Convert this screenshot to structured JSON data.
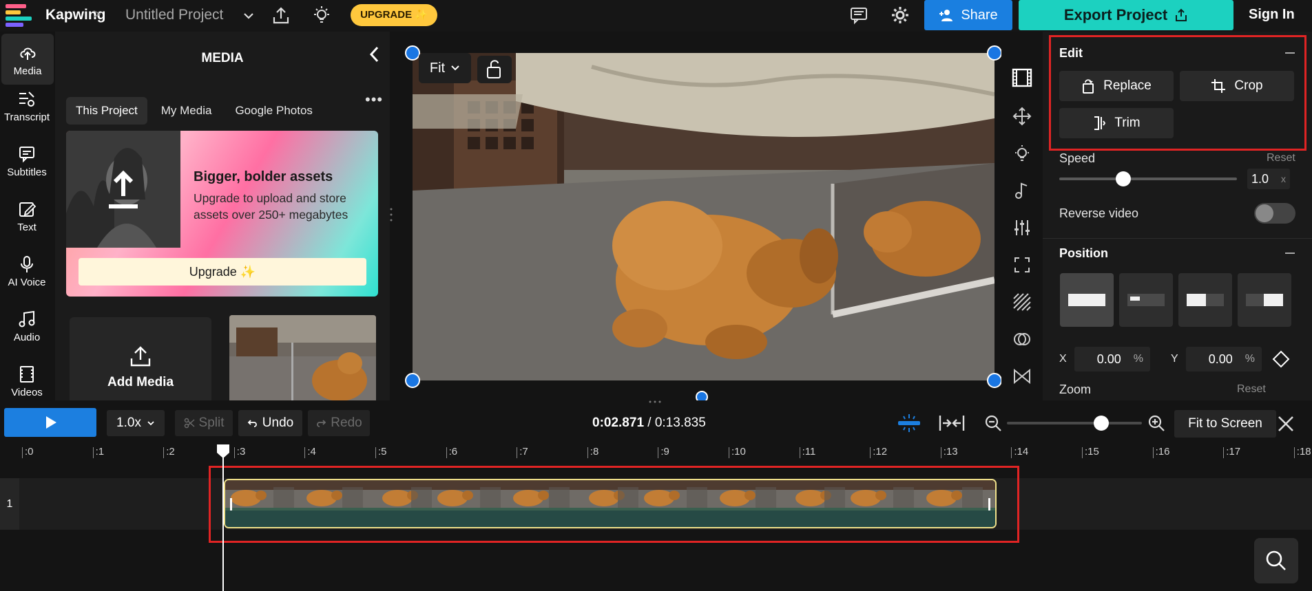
{
  "header": {
    "brand": "Kapwing",
    "separator": ">",
    "project_name": "Untitled Project",
    "upgrade_label": "UPGRADE ✨",
    "share_label": "Share",
    "export_label": "Export Project",
    "signin_label": "Sign In"
  },
  "rail": {
    "items": [
      {
        "label": "Media",
        "icon": "upload-cloud-icon"
      },
      {
        "label": "Transcript",
        "icon": "transcript-icon"
      },
      {
        "label": "Subtitles",
        "icon": "subtitles-icon"
      },
      {
        "label": "Text",
        "icon": "text-edit-icon"
      },
      {
        "label": "AI Voice",
        "icon": "microphone-icon"
      },
      {
        "label": "Audio",
        "icon": "music-note-icon"
      },
      {
        "label": "Videos",
        "icon": "film-icon"
      }
    ]
  },
  "media_panel": {
    "title": "MEDIA",
    "tabs": [
      "This Project",
      "My Media",
      "Google Photos"
    ],
    "more": "•••",
    "promo_title": "Bigger, bolder assets",
    "promo_text": "Upgrade to upload and store assets over 250+ megabytes",
    "promo_button": "Upgrade ✨",
    "add_media_label": "Add Media"
  },
  "canvas": {
    "fit_label": "Fit"
  },
  "edit": {
    "title": "Edit",
    "replace_label": "Replace",
    "crop_label": "Crop",
    "trim_label": "Trim"
  },
  "speed": {
    "label": "Speed",
    "reset": "Reset",
    "value": "1.0",
    "unit": "x",
    "slider_fraction": 0.36
  },
  "reverse": {
    "label": "Reverse video",
    "enabled": false
  },
  "position": {
    "title": "Position",
    "x_label": "X",
    "x_value": "0.00",
    "y_label": "Y",
    "y_value": "0.00",
    "unit": "%"
  },
  "zoom": {
    "label": "Zoom",
    "reset": "Reset"
  },
  "timeline": {
    "speed": "1.0x",
    "split": "Split",
    "undo": "Undo",
    "redo": "Redo",
    "current_time": "0:02.871",
    "duration": "/ 0:13.835",
    "fit_to_screen": "Fit to Screen",
    "zoom_fraction": 0.7,
    "track_number": "1",
    "ruler_ticks": [
      ":0",
      ":1",
      ":2",
      ":3",
      ":4",
      ":5",
      ":6",
      ":7",
      ":8",
      ":9",
      ":10",
      ":11",
      ":12",
      ":13",
      ":14",
      ":15",
      ":16",
      ":17",
      ":18"
    ]
  },
  "colors": {
    "accent_blue": "#1a7fe0",
    "export_teal": "#1cd1c0",
    "upgrade_yellow": "#ffc83d",
    "highlight_red": "#e02424",
    "clip_border": "#efe08a"
  }
}
